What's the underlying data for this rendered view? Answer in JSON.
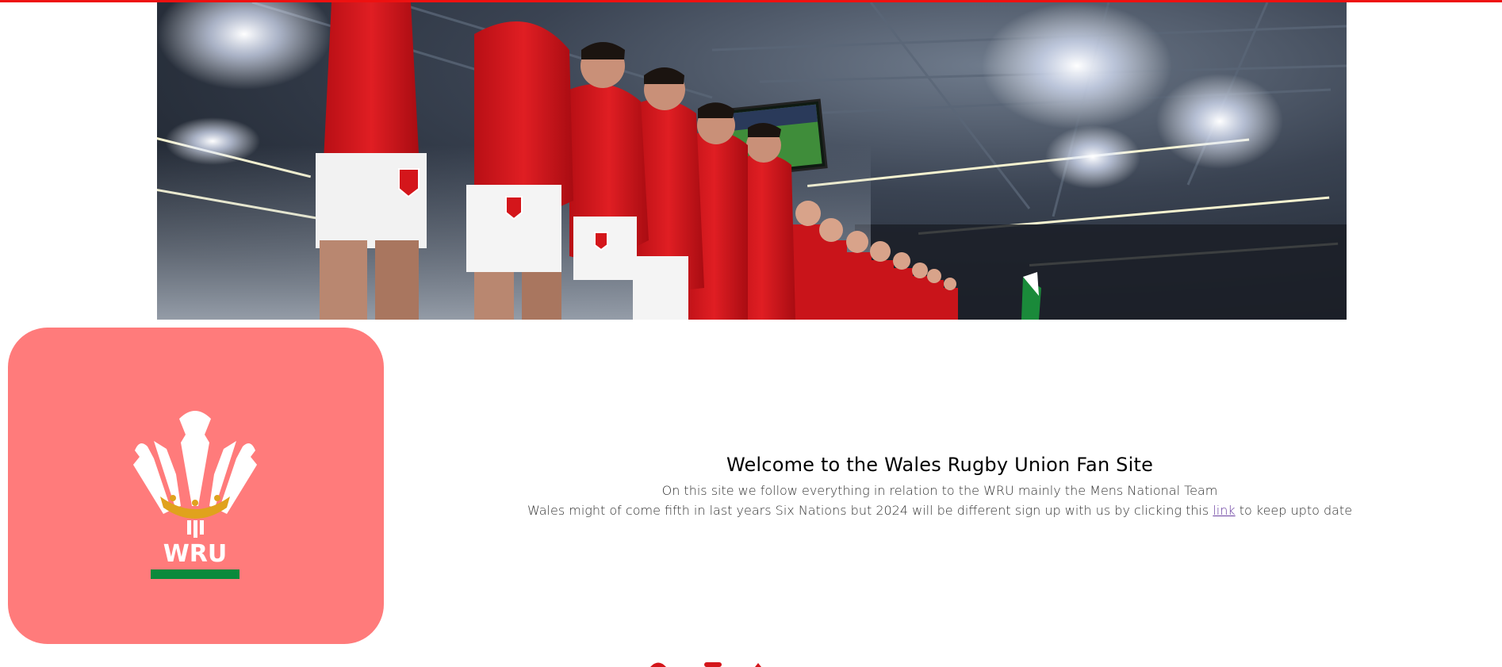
{
  "hero": {
    "alt": "Wales players lined up in the stadium",
    "colors": {
      "kit": "#d4161b",
      "shorts": "#f5f5f5",
      "sky": "#3b4452"
    }
  },
  "logo": {
    "text": "WRU",
    "colors": {
      "card": "#ff7b7b",
      "feathers": "#ffffff",
      "crown": "#e0a21d",
      "bar": "#0a8a3c"
    }
  },
  "welcome": {
    "title": "Welcome to the Wales Rugby Union Fan Site",
    "line1": "On this site we follow everything in relation to the WRU mainly the Mens National Team",
    "line2_before": "Wales might of come fifth in last years Six Nations but 2024 will be different sign up with us by clicking this ",
    "link_label": "link",
    "line2_after": " to keep upto date"
  },
  "theme": {
    "accent": "#ee1111"
  }
}
